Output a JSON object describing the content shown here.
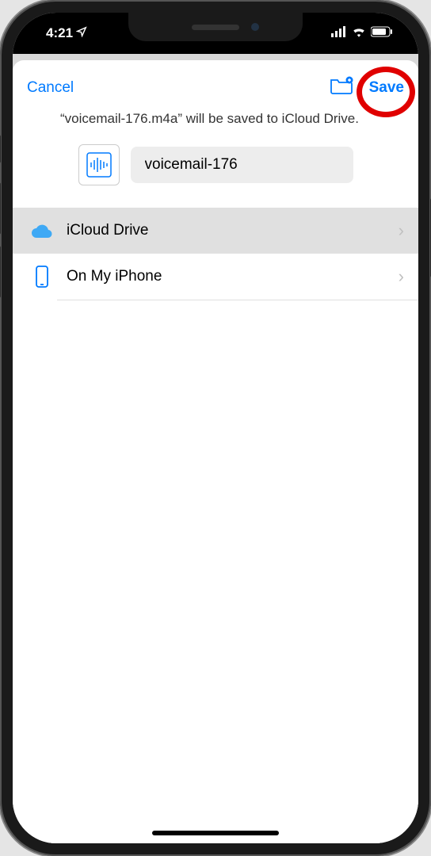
{
  "status": {
    "time": "4:21",
    "location_arrow": "↗",
    "signal_bars": 4,
    "wifi": true,
    "battery_pct": 80
  },
  "nav": {
    "cancel_label": "Cancel",
    "save_label": "Save"
  },
  "subtitle": "“voicemail-176.m4a” will be saved to iCloud Drive.",
  "file": {
    "name_value": "voicemail-176",
    "icon": "audio-waveform-icon"
  },
  "locations": [
    {
      "label": "iCloud Drive",
      "icon": "cloud-icon",
      "selected": true
    },
    {
      "label": "On My iPhone",
      "icon": "iphone-icon",
      "selected": false
    }
  ],
  "annotation": {
    "highlight_target": "save-button",
    "highlight_color": "#e00000"
  }
}
